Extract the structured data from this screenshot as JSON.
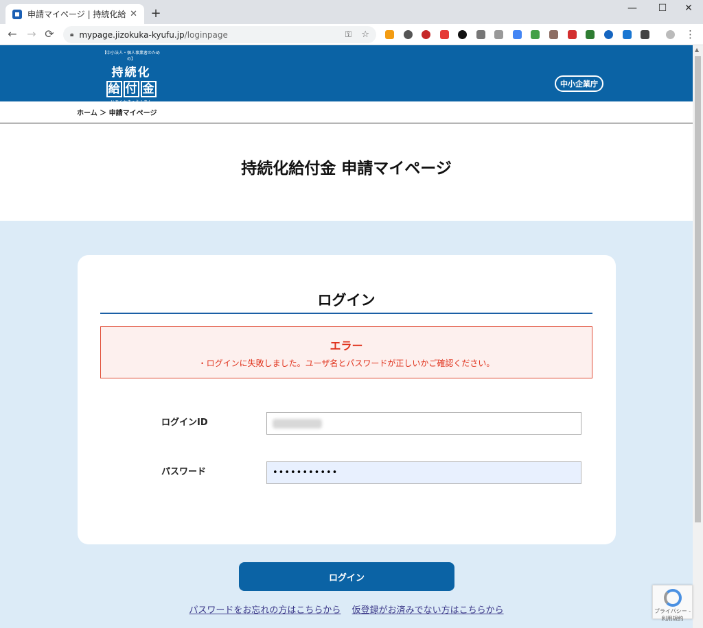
{
  "browser": {
    "tab_title": "申請マイページ | 持続化給付金",
    "tab_close": "✕",
    "new_tab": "+",
    "url_host": "mypage.jizokuka-kyufu.jp",
    "url_path": "/loginpage",
    "controls": {
      "minimize": "—",
      "maximize": "☐",
      "close": "✕"
    },
    "nav": {
      "back": "←",
      "forward": "→",
      "reload": "⟳"
    },
    "omni_icons": {
      "key": "⚿",
      "star": "☆"
    },
    "menu": "⋮"
  },
  "header": {
    "logo_top": "【中小法人・個人事業者のための】",
    "logo_line1": "持続化",
    "logo_line2": [
      "給",
      "付",
      "金"
    ],
    "logo_bottom": "じぞくかきゅうふきん",
    "agency": "中小企業庁"
  },
  "breadcrumb": "ホーム ＞ 申請マイページ",
  "page_title": "持続化給付金 申請マイページ",
  "login": {
    "title": "ログイン",
    "error_title": "エラー",
    "error_message": "・ログインに失敗しました。ユーザ名とパスワードが正しいかご確認ください。",
    "id_label": "ログインID",
    "id_value": "",
    "password_label": "パスワード",
    "password_value": "•••••••••••",
    "button": "ログイン"
  },
  "links": {
    "forgot_password": "パスワードをお忘れの方はこちらから",
    "not_registered": "仮登録がお済みでない方はこちらから"
  },
  "recaptcha": "プライバシー - 利用規約",
  "colors": {
    "header_blue": "#0b63a5",
    "error_red": "#e0321c",
    "bg_light_blue": "#dcebf7"
  }
}
